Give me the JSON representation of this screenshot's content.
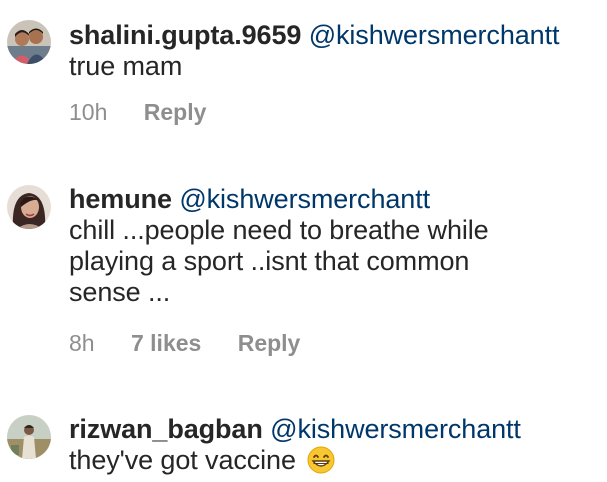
{
  "comments": [
    {
      "username": "shalini.gupta.9659",
      "mention": "@kishwersmerchantt",
      "text_lines": [
        "true mam"
      ],
      "time": "10h",
      "likes": "",
      "reply_label": "Reply",
      "avatar_icon": "avatar-photo-couple"
    },
    {
      "username": "hemune",
      "mention": "@kishwersmerchantt",
      "text_lines": [
        "chill ...people  need to breathe while",
        "playing a sport ..isnt that common",
        "sense ..."
      ],
      "time": "8h",
      "likes": "7 likes",
      "reply_label": "Reply",
      "avatar_icon": "avatar-photo-woman"
    },
    {
      "username": "rizwan_bagban",
      "mention": "@kishwersmerchantt",
      "text_lines": [
        "they've got vaccine"
      ],
      "emoji": "grinning-face-emoji",
      "time": "",
      "likes": "",
      "reply_label": "",
      "avatar_icon": "avatar-photo-man-outdoor"
    }
  ],
  "colors": {
    "text": "#262626",
    "mention": "#00376b",
    "meta": "#8e8e8e",
    "background": "#ffffff"
  }
}
